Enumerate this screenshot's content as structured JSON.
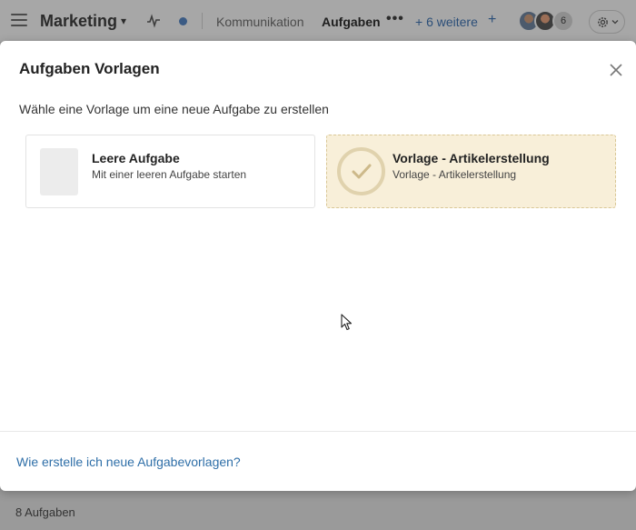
{
  "header": {
    "title": "Marketing",
    "tabs": [
      {
        "label": "Kommunikation",
        "active": false
      },
      {
        "label": "Aufgaben",
        "active": true
      }
    ],
    "more_tabs": "+ 6 weitere",
    "add_tab": "+",
    "more_dots": "•••",
    "member_count": "6",
    "colors": {
      "status_dot": "#3b5b84"
    }
  },
  "background": {
    "task_count_label": "8 Aufgaben"
  },
  "modal": {
    "title": "Aufgaben Vorlagen",
    "subtitle": "Wähle eine Vorlage um eine neue Aufgabe zu erstellen",
    "templates": [
      {
        "title": "Leere Aufgabe",
        "description": "Mit einer leeren Aufgabe starten",
        "selected": false,
        "icon": "blank-page-icon"
      },
      {
        "title": "Vorlage - Artikelerstellung",
        "description": "Vorlage - Artikelerstellung",
        "selected": true,
        "icon": "checkmark-icon"
      }
    ],
    "help_link": "Wie erstelle ich neue Aufgabevorlagen?",
    "colors": {
      "link": "#2f6fa8",
      "selected_bg": "#f8efd9",
      "selected_border": "#d9c796"
    }
  }
}
